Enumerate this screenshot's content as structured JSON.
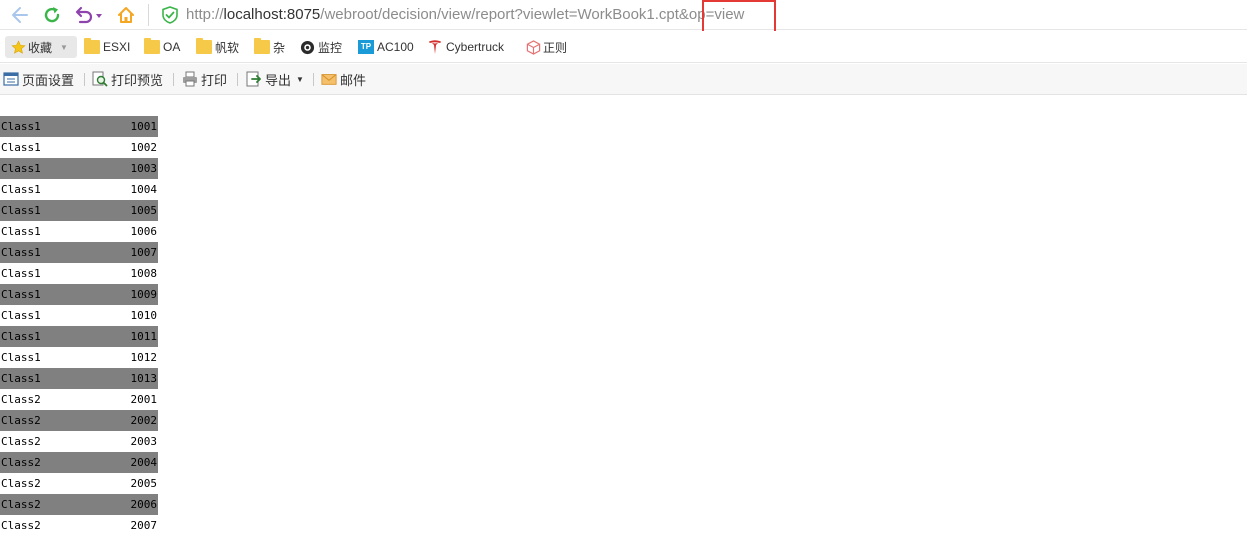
{
  "browser": {
    "url_prefix": "http://",
    "url_host": "localhost:8075",
    "url_path": "/webroot/decision/view/report?viewlet=WorkBook1.cpt&op=view",
    "icons": {
      "back": "arrow-left-icon",
      "refresh": "refresh-icon",
      "undo": "undo-icon",
      "home": "home-icon",
      "secure": "shield-check-icon"
    },
    "highlight_color": "#e53935"
  },
  "bookmarks": {
    "favorites_label": "收藏",
    "items": [
      {
        "label": "ESXI",
        "icon": "folder-icon"
      },
      {
        "label": "OA",
        "icon": "folder-icon"
      },
      {
        "label": "帆软",
        "icon": "folder-icon"
      },
      {
        "label": "杂",
        "icon": "folder-icon"
      },
      {
        "label": "监控",
        "icon": "camera-icon"
      },
      {
        "label": "AC100",
        "icon": "tp-link-icon"
      },
      {
        "label": "Cybertruck",
        "icon": "tesla-icon"
      },
      {
        "label": "正则",
        "icon": "cube-icon"
      }
    ]
  },
  "toolbar": {
    "page_setup": "页面设置",
    "print_preview": "打印预览",
    "print": "打印",
    "export": "导出",
    "mail": "邮件"
  },
  "report": {
    "shade_color": "#808080",
    "rows": [
      {
        "name": "Class1",
        "id": "1001",
        "shaded": true
      },
      {
        "name": "Class1",
        "id": "1002",
        "shaded": false
      },
      {
        "name": "Class1",
        "id": "1003",
        "shaded": true
      },
      {
        "name": "Class1",
        "id": "1004",
        "shaded": false
      },
      {
        "name": "Class1",
        "id": "1005",
        "shaded": true
      },
      {
        "name": "Class1",
        "id": "1006",
        "shaded": false
      },
      {
        "name": "Class1",
        "id": "1007",
        "shaded": true
      },
      {
        "name": "Class1",
        "id": "1008",
        "shaded": false
      },
      {
        "name": "Class1",
        "id": "1009",
        "shaded": true
      },
      {
        "name": "Class1",
        "id": "1010",
        "shaded": false
      },
      {
        "name": "Class1",
        "id": "1011",
        "shaded": true
      },
      {
        "name": "Class1",
        "id": "1012",
        "shaded": false
      },
      {
        "name": "Class1",
        "id": "1013",
        "shaded": true
      },
      {
        "name": "Class2",
        "id": "2001",
        "shaded": false
      },
      {
        "name": "Class2",
        "id": "2002",
        "shaded": true
      },
      {
        "name": "Class2",
        "id": "2003",
        "shaded": false
      },
      {
        "name": "Class2",
        "id": "2004",
        "shaded": true
      },
      {
        "name": "Class2",
        "id": "2005",
        "shaded": false
      },
      {
        "name": "Class2",
        "id": "2006",
        "shaded": true
      },
      {
        "name": "Class2",
        "id": "2007",
        "shaded": false
      }
    ]
  }
}
